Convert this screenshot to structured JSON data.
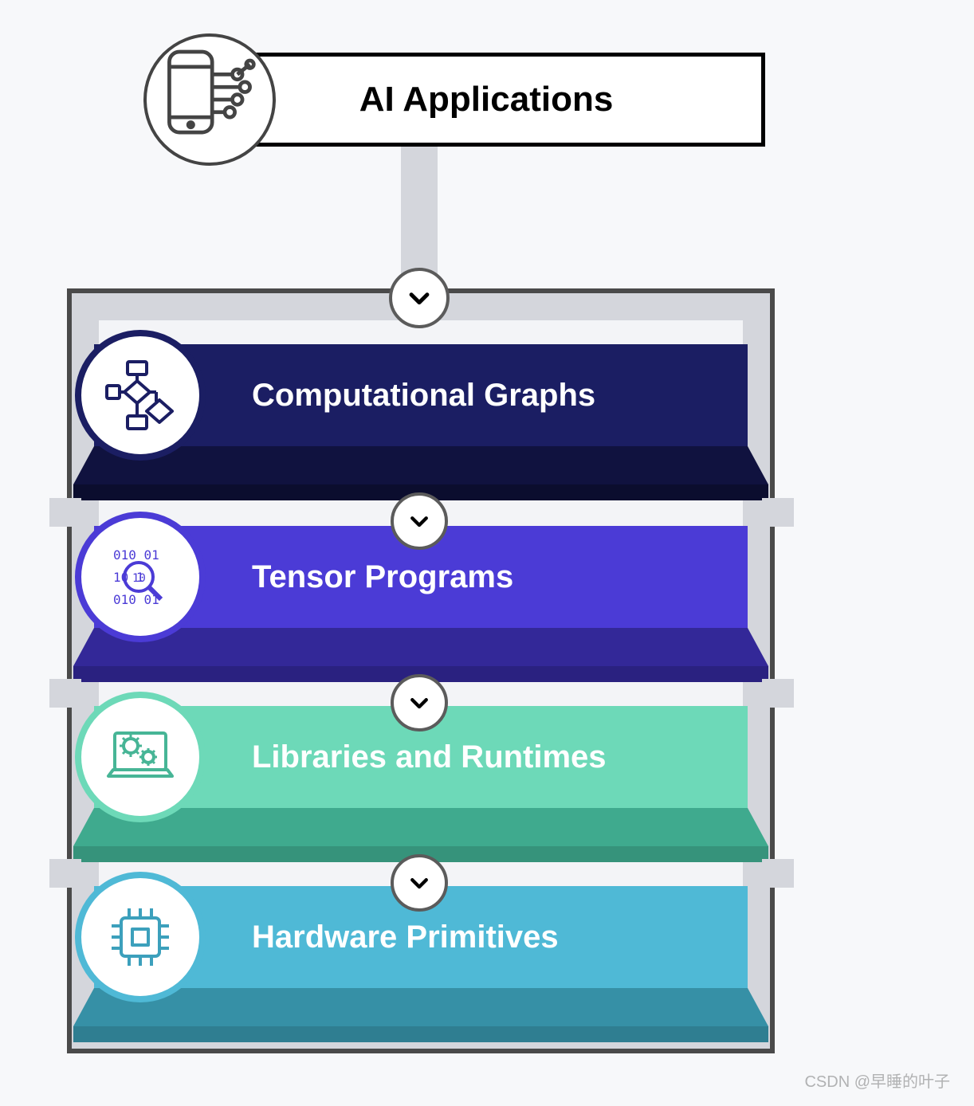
{
  "header": {
    "title": "AI Applications",
    "icon": "app-ai-icon"
  },
  "layers": [
    {
      "label": "Computational Graphs",
      "icon": "flowchart-icon",
      "colors": {
        "main": "#1b1e63",
        "slope": "#10123f",
        "front": "#0b0d2e"
      }
    },
    {
      "label": "Tensor Programs",
      "icon": "binary-magnify-icon",
      "colors": {
        "main": "#4b3bd6",
        "slope": "#332898",
        "front": "#2a2180"
      }
    },
    {
      "label": "Libraries and Runtimes",
      "icon": "laptop-gears-icon",
      "colors": {
        "main": "#6dd9b8",
        "slope": "#3faa8e",
        "front": "#36937b"
      }
    },
    {
      "label": "Hardware Primitives",
      "icon": "chip-icon",
      "colors": {
        "main": "#4fb9d6",
        "slope": "#3690a6",
        "front": "#2f7e91"
      }
    }
  ],
  "arrows": {
    "symbol": "chevron-down-icon"
  },
  "watermark": "CSDN @早睡的叶子"
}
